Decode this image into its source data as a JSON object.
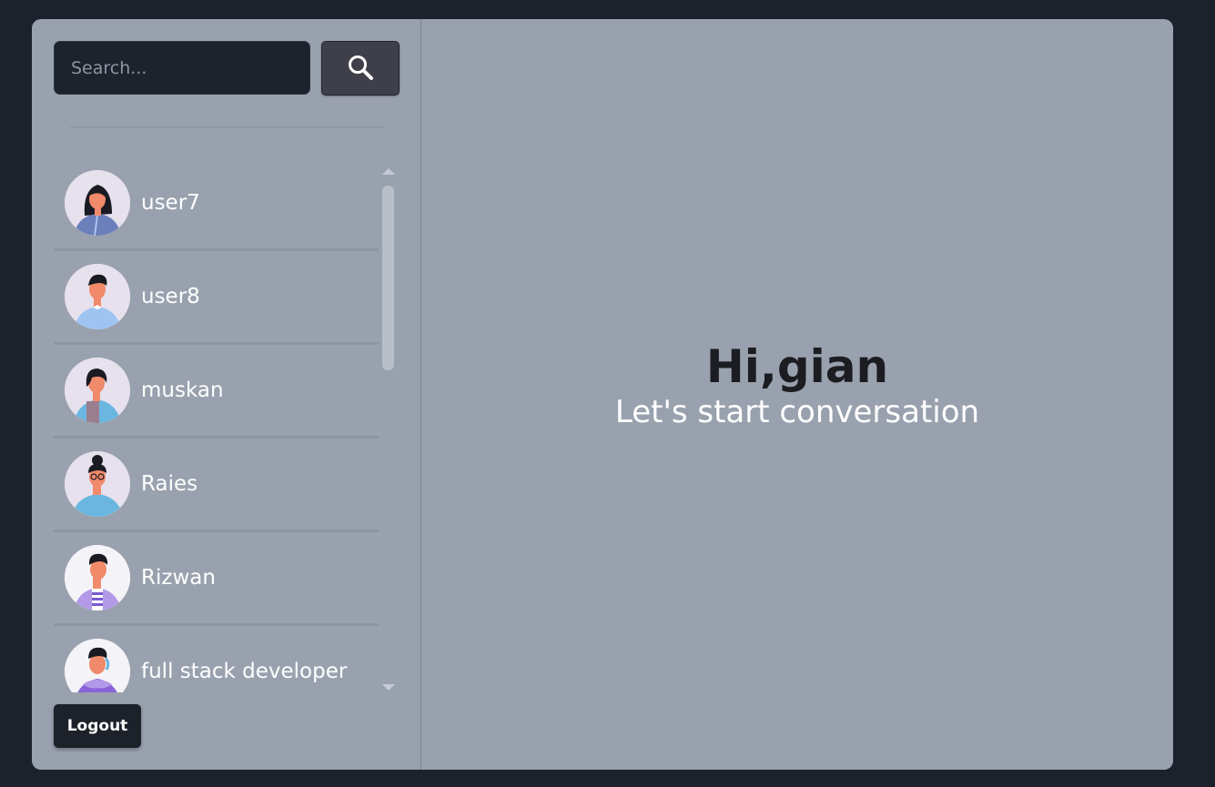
{
  "search": {
    "placeholder": "Search..."
  },
  "users": [
    {
      "name": "user7"
    },
    {
      "name": "user8"
    },
    {
      "name": "muskan"
    },
    {
      "name": "Raies"
    },
    {
      "name": "Rizwan"
    },
    {
      "name": "full stack developer"
    }
  ],
  "sidebar": {
    "logout_label": "Logout"
  },
  "main": {
    "greeting": "Hi,gian",
    "subtitle": "Let's start conversation"
  },
  "colors": {
    "background": "#1c222b",
    "panel": "#9aa1ae",
    "input": "#1d232c",
    "button": "#3e3f48",
    "logout": "#1d212a"
  },
  "icons": [
    "search-icon",
    "scroll-up-arrow-icon",
    "scroll-down-arrow-icon"
  ]
}
